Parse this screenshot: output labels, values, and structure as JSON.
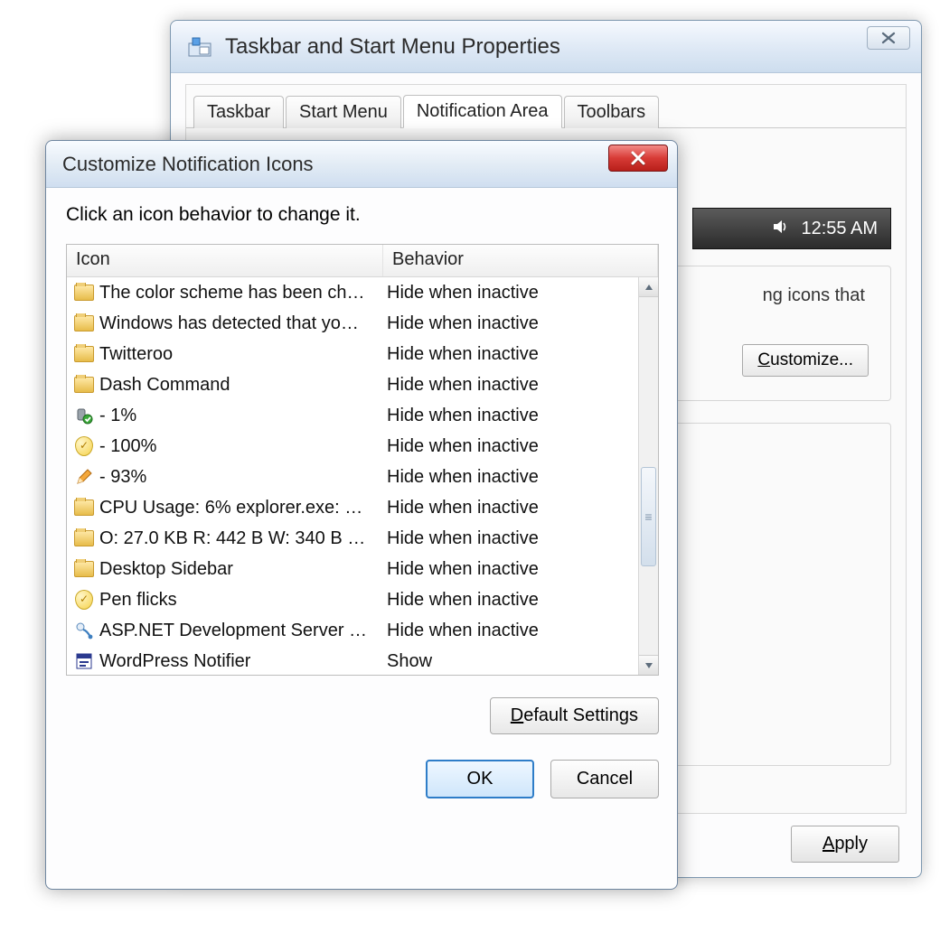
{
  "back_window": {
    "title": "Taskbar and Start Menu Properties",
    "tabs": [
      "Taskbar",
      "Start Menu",
      "Notification Area",
      "Toolbars"
    ],
    "active_tab_index": 2,
    "clock_time": "12:55 AM",
    "desc_fragment": "ng icons that",
    "customize_button": "Customize...",
    "apply_button": "Apply"
  },
  "dialog": {
    "title": "Customize Notification Icons",
    "instruction": "Click an icon behavior to change it.",
    "columns": {
      "icon": "Icon",
      "behavior": "Behavior"
    },
    "rows": [
      {
        "icon": "folder",
        "label": "The color scheme has been ch…",
        "behavior": "Hide when inactive"
      },
      {
        "icon": "folder",
        "label": "Windows has detected that yo…",
        "behavior": "Hide when inactive"
      },
      {
        "icon": "folder",
        "label": "Twitteroo",
        "behavior": "Hide when inactive"
      },
      {
        "icon": "folder",
        "label": "Dash Command",
        "behavior": "Hide when inactive"
      },
      {
        "icon": "usb",
        "label": " - 1%",
        "behavior": "Hide when inactive"
      },
      {
        "icon": "shield",
        "label": " - 100%",
        "behavior": "Hide when inactive"
      },
      {
        "icon": "pencil",
        "label": " - 93%",
        "behavior": "Hide when inactive"
      },
      {
        "icon": "folder",
        "label": "CPU Usage: 6% explorer.exe: …",
        "behavior": "Hide when inactive"
      },
      {
        "icon": "folder",
        "label": "O: 27.0  KB R: 442 B W: 340 B …",
        "behavior": "Hide when inactive"
      },
      {
        "icon": "folder",
        "label": "Desktop Sidebar",
        "behavior": "Hide when inactive"
      },
      {
        "icon": "shield",
        "label": "Pen flicks",
        "behavior": "Hide when inactive"
      },
      {
        "icon": "server",
        "label": "ASP.NET Development Server …",
        "behavior": "Hide when inactive"
      },
      {
        "icon": "notifier",
        "label": "WordPress Notifier",
        "behavior": "Show"
      }
    ],
    "default_settings_button": "Default Settings",
    "ok_button": "OK",
    "cancel_button": "Cancel"
  }
}
